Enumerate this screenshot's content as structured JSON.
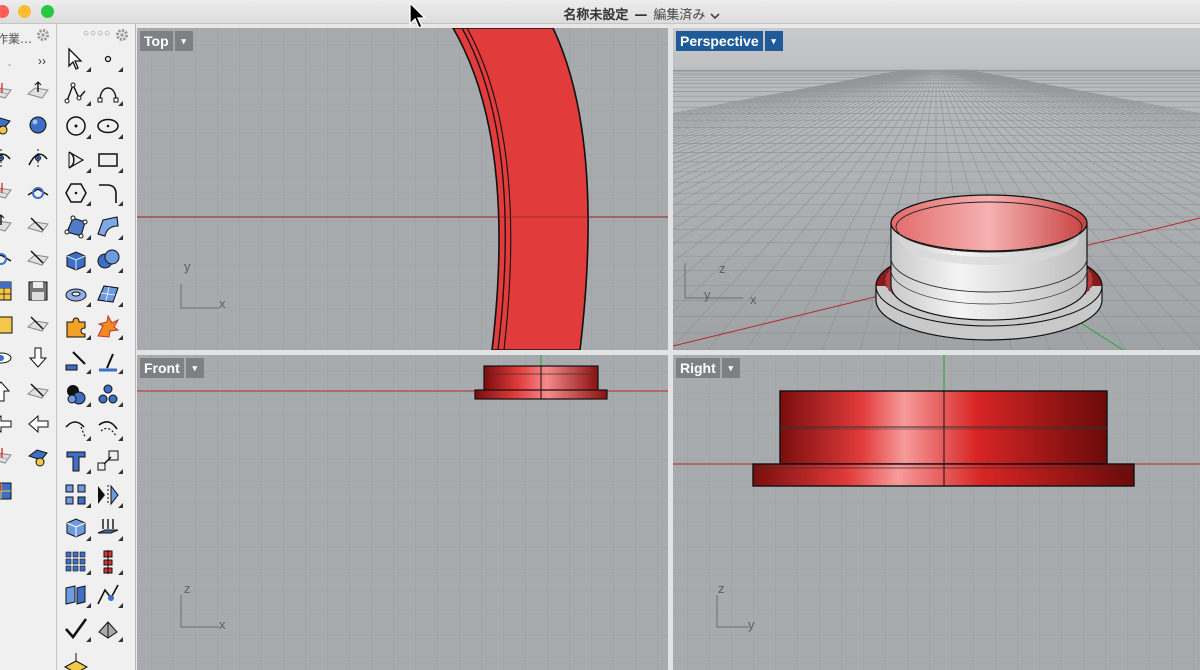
{
  "window": {
    "title": "名称未設定",
    "separator": "—",
    "status": "編集済み",
    "status_chevron": "chevron-down-icon"
  },
  "panels": {
    "left": {
      "title": "作業…",
      "gear_icon": "gear-icon",
      "more_icon": "double-chevron-right-icon"
    },
    "tools": {
      "handle_icon": "drag-handle-dots-icon",
      "gear_icon": "gear-icon"
    }
  },
  "viewports": {
    "top": {
      "label": "Top",
      "axis_a": "y",
      "axis_b": "x"
    },
    "perspective": {
      "label": "Perspective",
      "axis_a": "z",
      "axis_b": "y",
      "axis_c": "x"
    },
    "front": {
      "label": "Front",
      "axis_a": "z",
      "axis_b": "x"
    },
    "right": {
      "label": "Right",
      "axis_a": "z",
      "axis_b": "y"
    }
  },
  "dropdown_glyph": "▾",
  "colors": {
    "object_red": "#e23b3b",
    "active_viewport": "#1f5b98",
    "viewport_bg": "#a7abae",
    "x_axis": "#b5282a",
    "y_axis": "#1fa62b"
  }
}
